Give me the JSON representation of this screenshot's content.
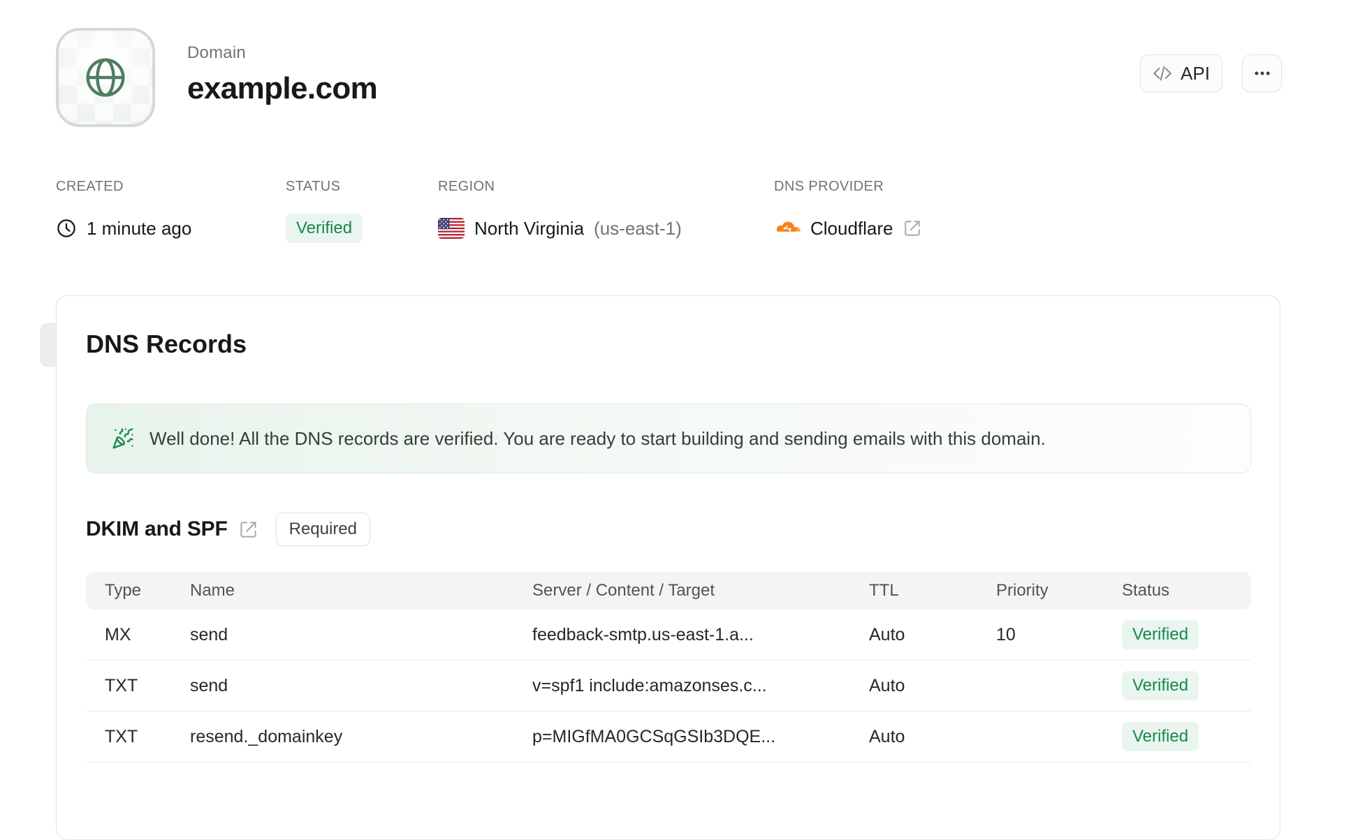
{
  "header": {
    "label": "Domain",
    "title": "example.com",
    "api_button_label": "API"
  },
  "meta": {
    "created": {
      "label": "CREATED",
      "value": "1 minute ago"
    },
    "status": {
      "label": "STATUS",
      "value": "Verified"
    },
    "region": {
      "label": "REGION",
      "value": "North Virginia",
      "code": "(us-east-1)"
    },
    "dns_provider": {
      "label": "DNS PROVIDER",
      "value": "Cloudflare"
    }
  },
  "dns_card": {
    "title": "DNS Records",
    "banner_text": "Well done! All the DNS records are verified. You are ready to start building and sending emails with this domain.",
    "section": {
      "title": "DKIM and SPF",
      "badge": "Required"
    },
    "table": {
      "headers": [
        "Type",
        "Name",
        "Server / Content / Target",
        "TTL",
        "Priority",
        "Status"
      ],
      "rows": [
        {
          "type": "MX",
          "name": "send",
          "content": "feedback-smtp.us-east-1.a...",
          "ttl": "Auto",
          "priority": "10",
          "status": "Verified"
        },
        {
          "type": "TXT",
          "name": "send",
          "content": "v=spf1 include:amazonses.c...",
          "ttl": "Auto",
          "priority": "",
          "status": "Verified"
        },
        {
          "type": "TXT",
          "name": "resend._domainkey",
          "content": "p=MIGfMA0GCSqGSIb3DQE...",
          "ttl": "Auto",
          "priority": "",
          "status": "Verified"
        }
      ]
    }
  },
  "colors": {
    "status_green_text": "#17874d",
    "status_green_bg": "#e9f5ee",
    "banner_green": "#e8f3eb",
    "cloudflare_orange": "#f6821f",
    "globe_green": "#4e7d60",
    "border_gray": "#e4e4e7",
    "muted_text": "#71717a"
  }
}
